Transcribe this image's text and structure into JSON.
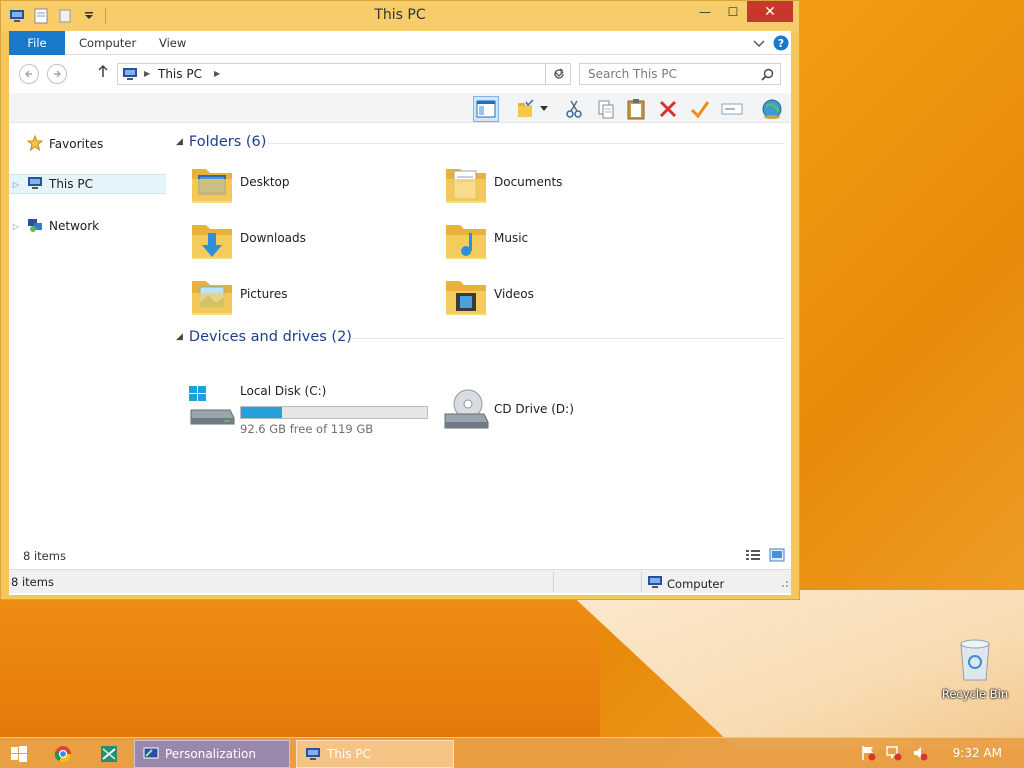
{
  "window": {
    "title": "This PC",
    "controls": {
      "minimize": "—",
      "maximize": "☐",
      "close": "✕"
    }
  },
  "ribbon": {
    "tabs": [
      "File",
      "Computer",
      "View"
    ]
  },
  "address": {
    "path": "This PC",
    "search_placeholder": "Search This PC"
  },
  "navpane": {
    "items": [
      "Favorites",
      "This PC",
      "Network"
    ]
  },
  "folders": {
    "header": "Folders (6)",
    "items": [
      "Desktop",
      "Documents",
      "Downloads",
      "Music",
      "Pictures",
      "Videos"
    ]
  },
  "drives": {
    "header": "Devices and drives (2)",
    "items": [
      {
        "name": "Local Disk (C:)",
        "free_text": "92.6 GB free of 119 GB",
        "used_fraction": 0.22
      },
      {
        "name": "CD Drive (D:)"
      }
    ]
  },
  "status": {
    "inner_count": "8 items",
    "bar_count": "8 items",
    "location": "Computer"
  },
  "desktop": {
    "recycle_bin": "Recycle Bin"
  },
  "taskbar": {
    "apps": [
      "Personalization",
      "This PC"
    ],
    "clock": "9:32 AM"
  },
  "colors": {
    "accent": "#1979ca",
    "drive_fill": "#26a0da",
    "group_header": "#1e3f8a",
    "close_button": "#c7372c"
  }
}
